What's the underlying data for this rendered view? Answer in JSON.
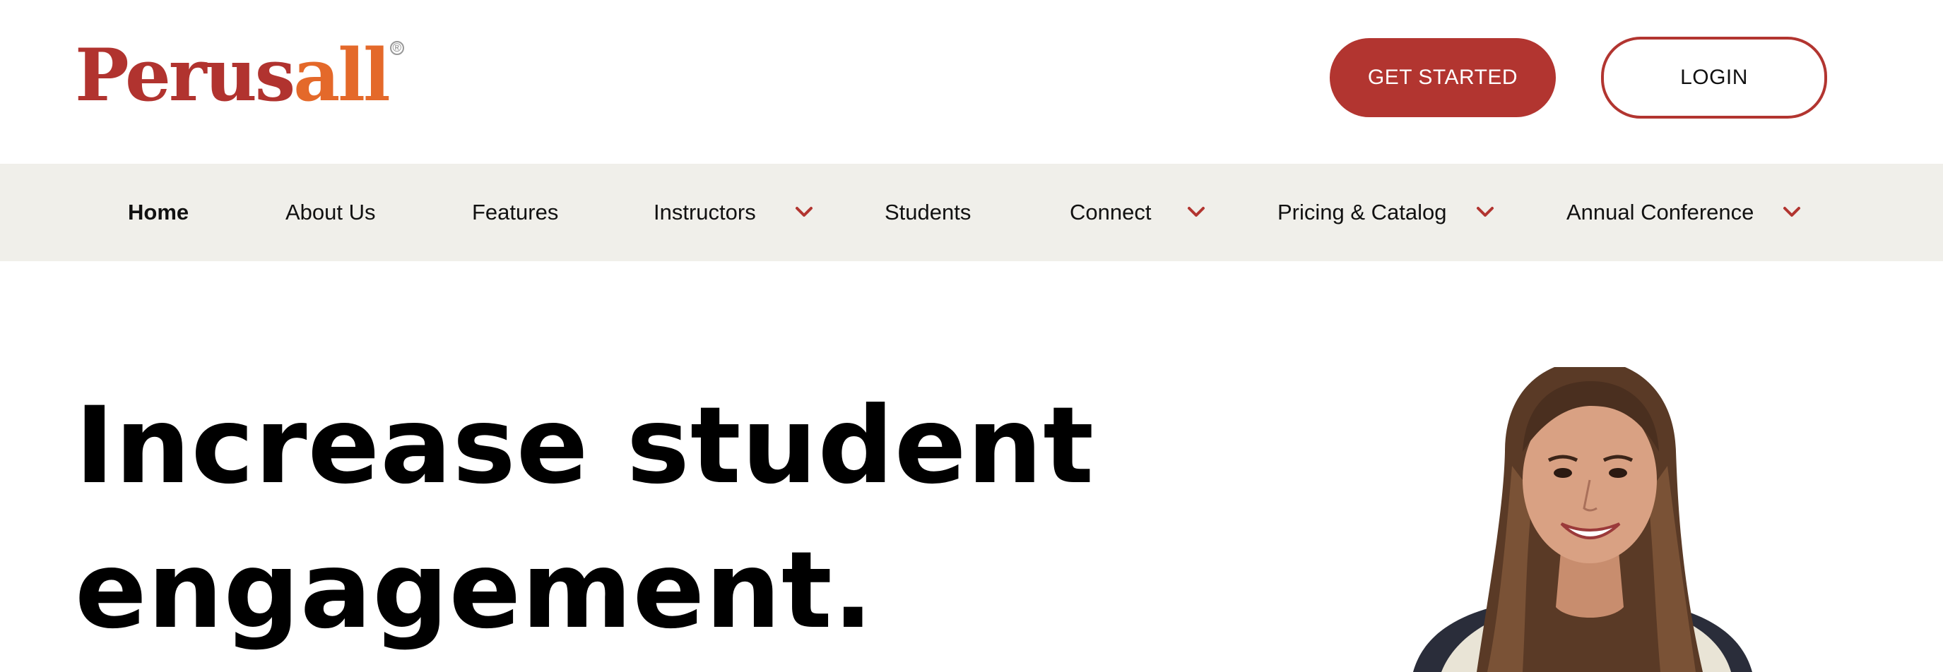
{
  "header": {
    "logo_part1": "Perus",
    "logo_part2": "all",
    "logo_reg": "®",
    "get_started_label": "GET STARTED",
    "login_label": "LOGIN"
  },
  "nav": {
    "items": [
      {
        "label": "Home"
      },
      {
        "label": "About Us"
      },
      {
        "label": "Features"
      },
      {
        "label": "Instructors"
      },
      {
        "label": "Students"
      },
      {
        "label": "Connect"
      },
      {
        "label": "Pricing & Catalog"
      },
      {
        "label": "Annual Conference"
      }
    ]
  },
  "hero": {
    "title_line1": "Increase student",
    "title_line2": "engagement."
  },
  "colors": {
    "brand_red": "#b23530",
    "brand_orange": "#e4692a",
    "nav_bg": "#f0efea"
  },
  "icons": {
    "dropdown": "chevron-down-icon"
  }
}
